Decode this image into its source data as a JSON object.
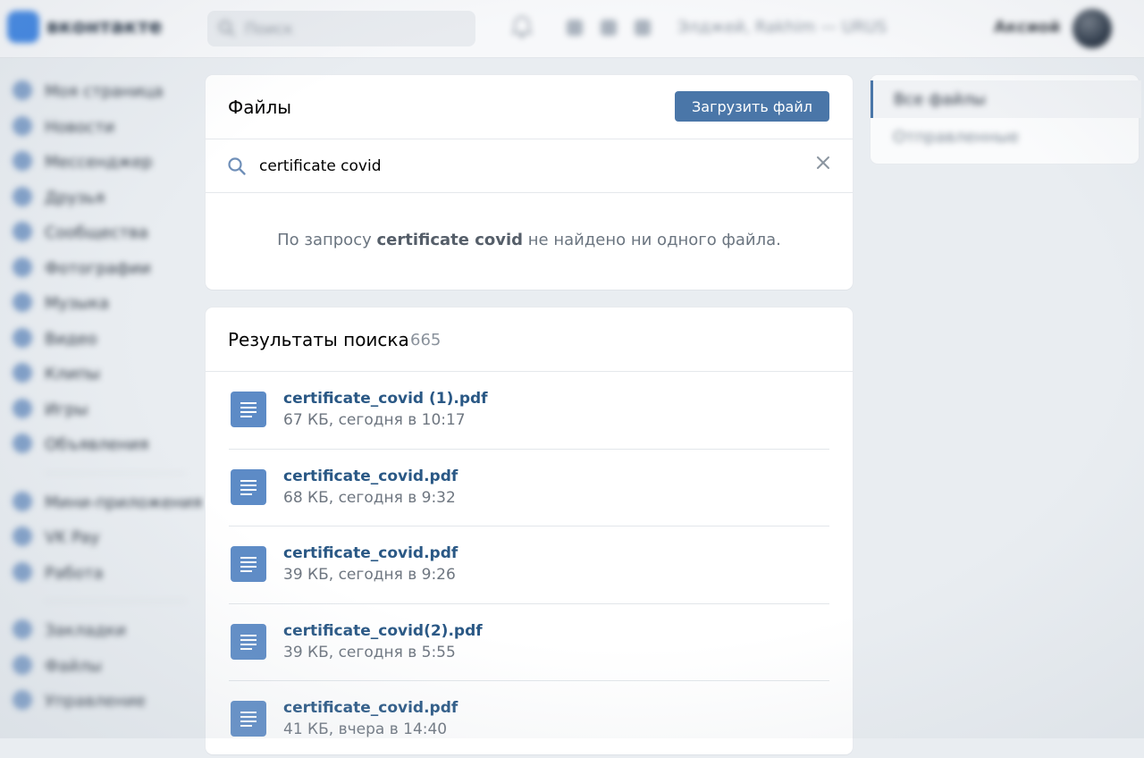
{
  "header": {
    "logo_text": "вконтакте",
    "search_placeholder": "Поиск",
    "now_playing": "Элджей, Rakhim — URUS",
    "username": "Аксиой"
  },
  "sidebar": {
    "items": [
      {
        "label": "Моя страница"
      },
      {
        "label": "Новости"
      },
      {
        "label": "Мессенджер"
      },
      {
        "label": "Друзья"
      },
      {
        "label": "Сообщества"
      },
      {
        "label": "Фотографии"
      },
      {
        "label": "Музыка"
      },
      {
        "label": "Видео"
      },
      {
        "label": "Клипы"
      },
      {
        "label": "Игры"
      },
      {
        "label": "Объявления"
      }
    ],
    "group2": [
      {
        "label": "Мини-приложения"
      },
      {
        "label": "VK Pay"
      },
      {
        "label": "Работа"
      }
    ],
    "group3": [
      {
        "label": "Закладки"
      },
      {
        "label": "Файлы"
      },
      {
        "label": "Управление"
      }
    ]
  },
  "files": {
    "title": "Файлы",
    "upload_label": "Загрузить файл",
    "search_value": "certificate covid",
    "empty_prefix": "По запросу ",
    "empty_query": "certificate covid",
    "empty_suffix": " не найдено ни одного файла."
  },
  "results": {
    "title": "Результаты поиска",
    "count": "665",
    "items": [
      {
        "name": "certificate_covid (1).pdf",
        "meta": "67 КБ, сегодня в 10:17"
      },
      {
        "name": "certificate_covid.pdf",
        "meta": "68 КБ, сегодня в 9:32"
      },
      {
        "name": "certificate_covid.pdf",
        "meta": "39 КБ, сегодня в 9:26"
      },
      {
        "name": "certificate_covid(2).pdf",
        "meta": "39 КБ, сегодня в 5:55"
      },
      {
        "name": "certificate_covid.pdf",
        "meta": "41 КБ, вчера в 14:40"
      }
    ]
  },
  "right_menu": {
    "all_files": "Все файлы",
    "sent": "Отправленные"
  },
  "colors": {
    "accent": "#4a76a8",
    "link": "#2a5885",
    "doc_icon": "#5d8bc6"
  }
}
